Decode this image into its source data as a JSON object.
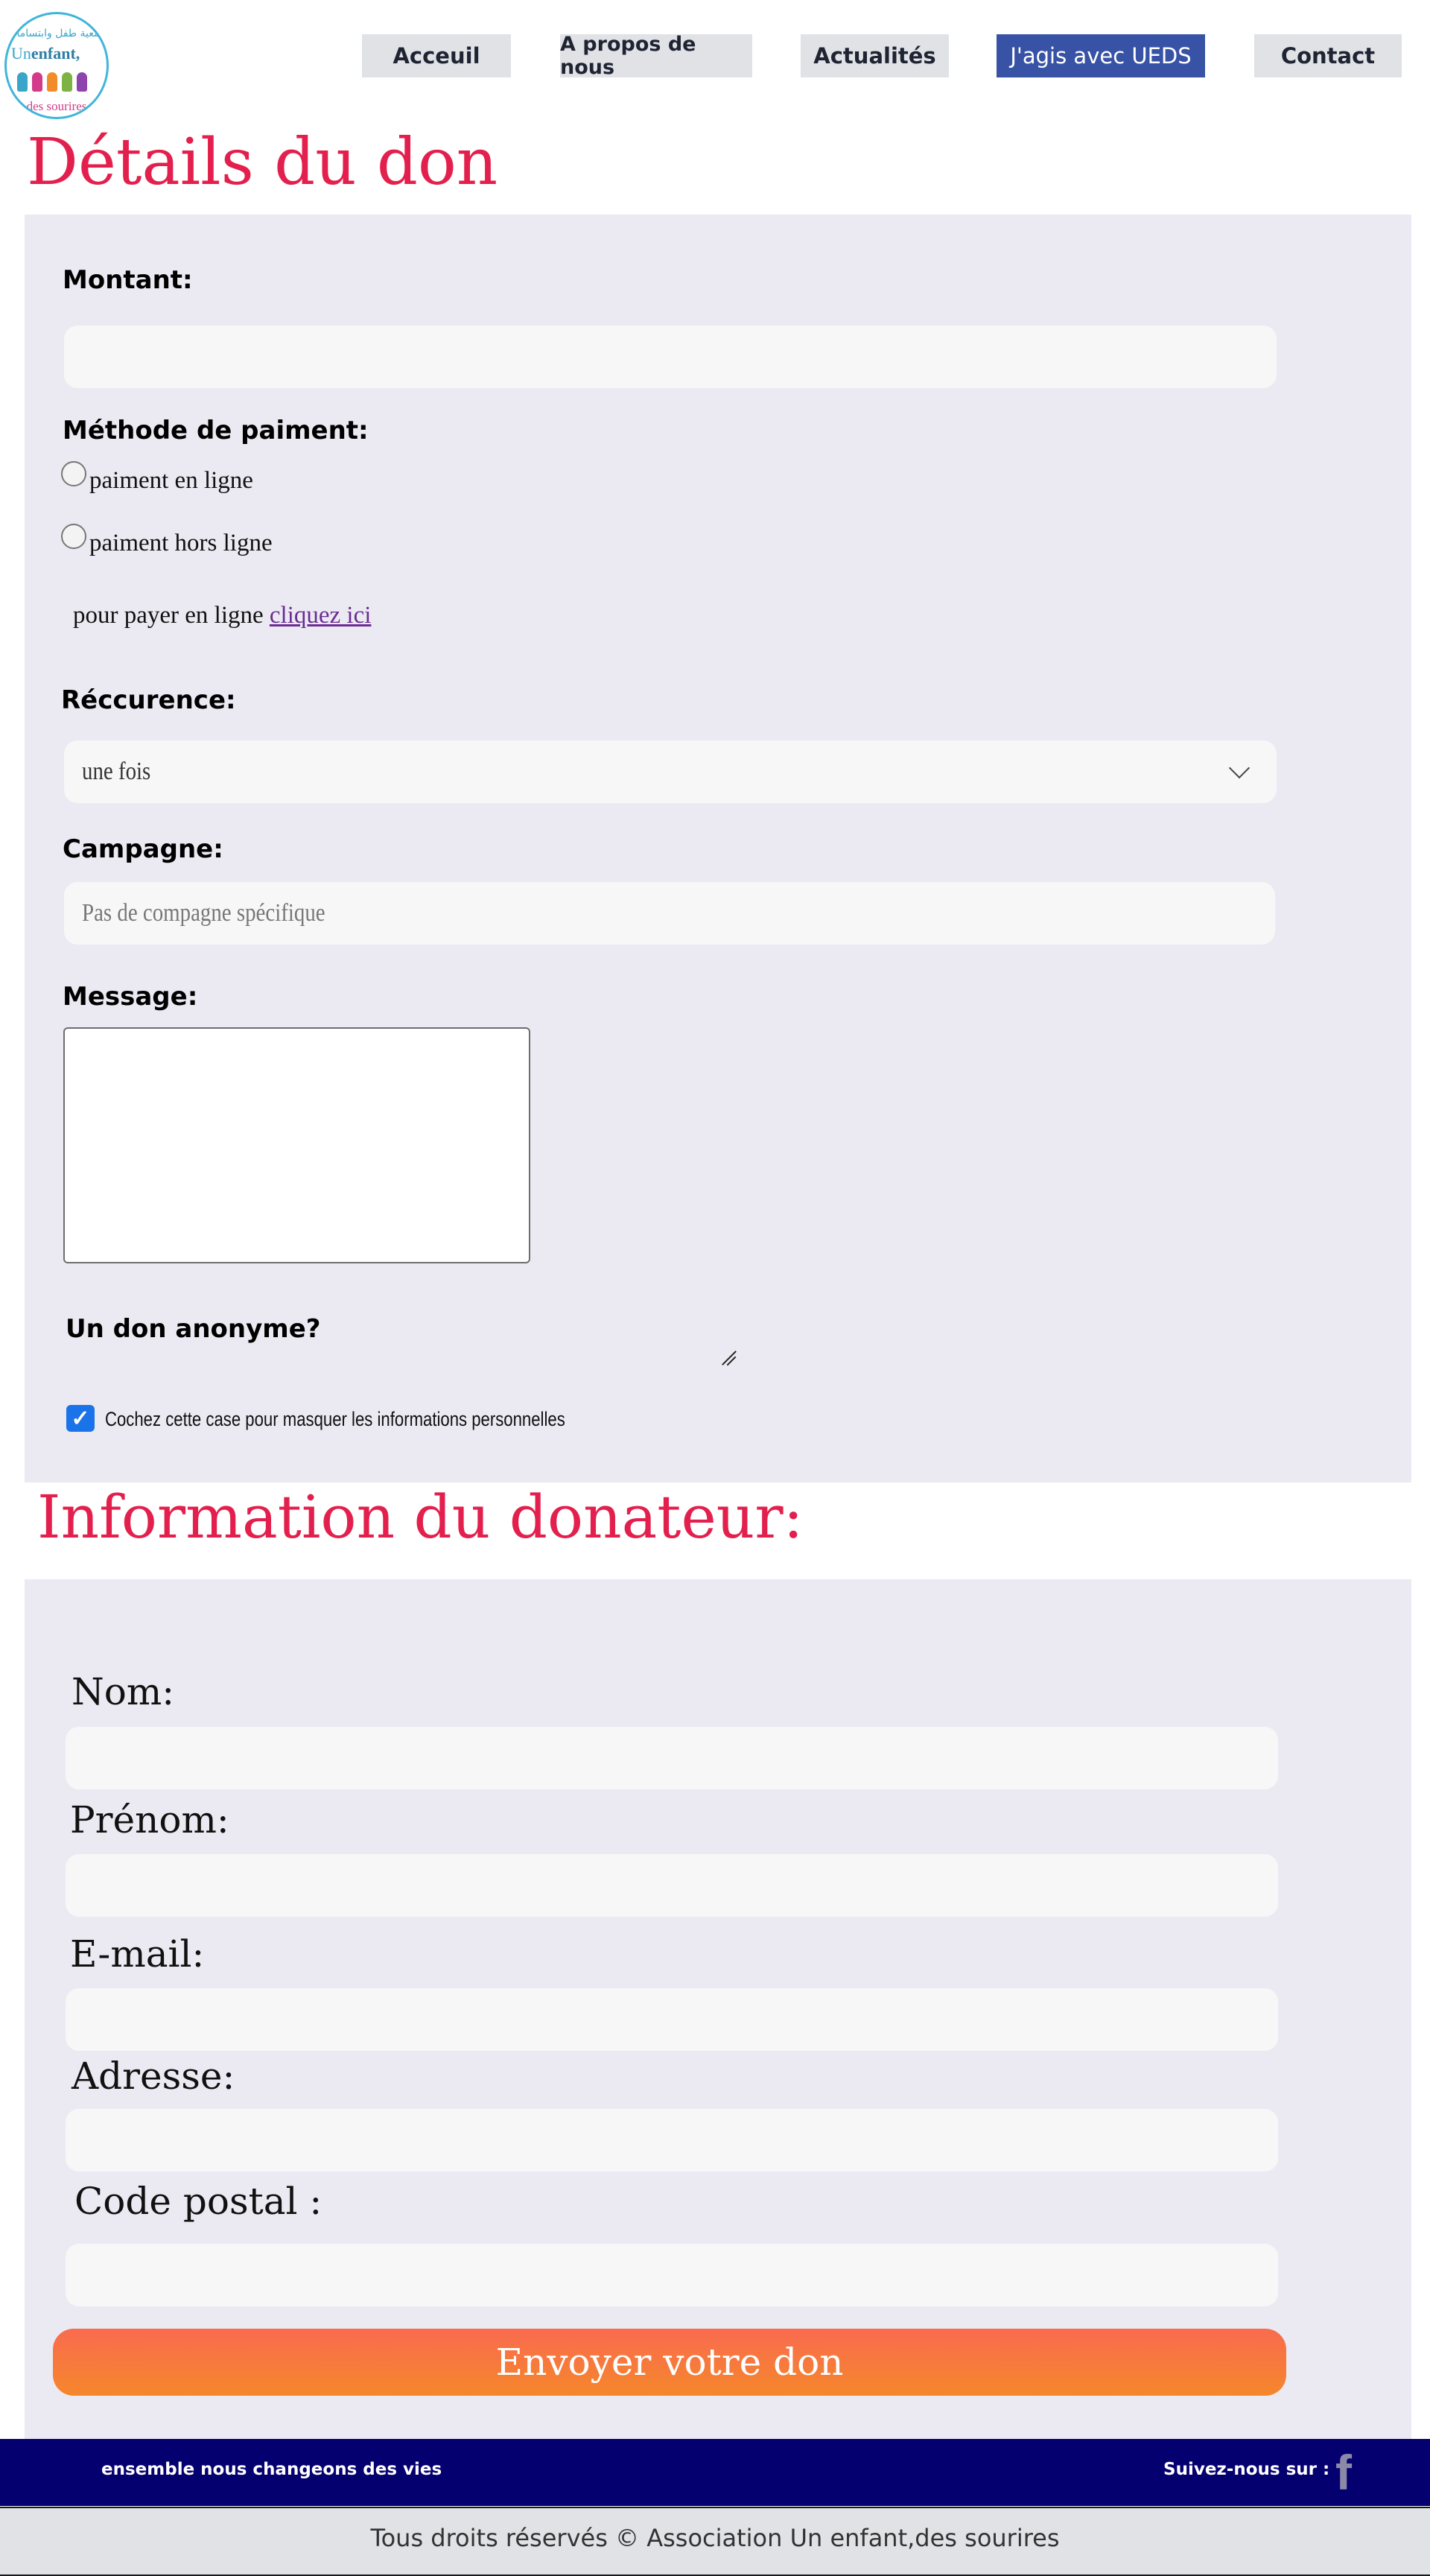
{
  "logo": {
    "arabic_text": "جمعية طفل وابتسامات",
    "name_line1_a": "Un",
    "name_line1_b": "enfant,",
    "name_line2": "des sourires"
  },
  "nav": {
    "items": [
      {
        "label": "Acceuil"
      },
      {
        "label": "A propos de nous"
      },
      {
        "label": "Actualités"
      },
      {
        "label": "J'agis avec UEDS"
      },
      {
        "label": "Contact"
      }
    ],
    "active_index": 3
  },
  "donation": {
    "heading": "Détails du don",
    "amount_label": "Montant:",
    "amount_value": "",
    "payment_label": "Méthode de paiment:",
    "payment_options": [
      {
        "label": "paiment en ligne",
        "selected": false
      },
      {
        "label": "paiment  hors ligne",
        "selected": false
      }
    ],
    "pay_online_text": "pour payer en ligne",
    "pay_online_link": "cliquez ici",
    "recurrence_label": "Réccurence:",
    "recurrence_value": "une fois",
    "campaign_label": "Campagne:",
    "campaign_placeholder": "Pas de compagne spécifique",
    "message_label": "Message:",
    "message_value": "",
    "anonymous_label": "Un don anonyme?",
    "anonymous_checkbox_label": "Cochez cette case pour masquer les informations personnelles",
    "anonymous_checked": true
  },
  "donor": {
    "heading": "Information du donateur:",
    "fields": [
      {
        "label": "Nom:",
        "value": ""
      },
      {
        "label": "Prénom:",
        "value": ""
      },
      {
        "label": "E-mail:",
        "value": ""
      },
      {
        "label": "Adresse:",
        "value": ""
      },
      {
        "label": "Code postal :",
        "value": ""
      }
    ],
    "submit_label": "Envoyer votre don"
  },
  "footer": {
    "slogan": "ensemble nous changeons des vies",
    "follow": "Suivez-nous sur :",
    "facebook_icon": "f",
    "copyright": "Tous droits réservés © Association Un enfant,des sourires"
  },
  "colors": {
    "accent_red": "#e3204d",
    "nav_active": "#3853a6",
    "panel_bg": "#ebeaf2",
    "footer_navy": "#05006f",
    "submit_orange": "#f5872b"
  }
}
